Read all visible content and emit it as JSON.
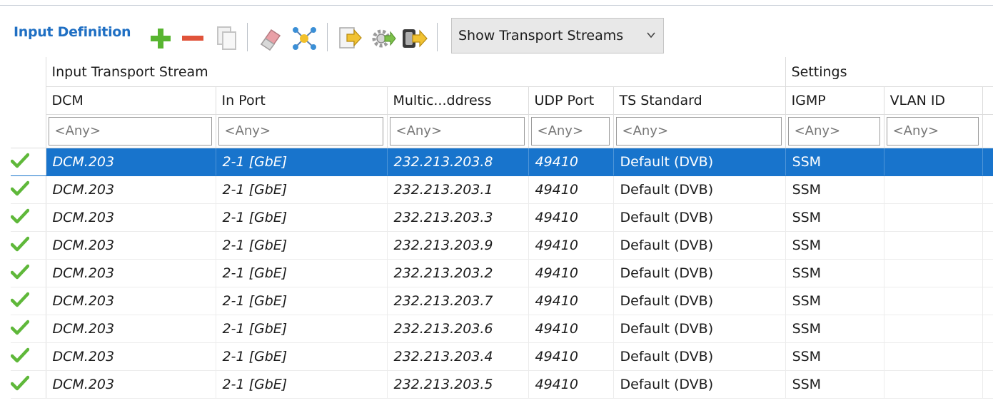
{
  "toolbar": {
    "title": "Input Definition",
    "icons": [
      "add-icon",
      "remove-icon",
      "copy-icon",
      "eraser-icon",
      "network-icon",
      "import-icon",
      "settings-gear-icon",
      "export-icon"
    ],
    "dropdown_value": "Show Transport Streams"
  },
  "table": {
    "groups": [
      {
        "label": ""
      },
      {
        "label": "Input Transport Stream"
      },
      {
        "label": "Settings"
      }
    ],
    "columns": [
      "DCM",
      "In Port",
      "Multic...ddress",
      "UDP Port",
      "TS Standard",
      "IGMP",
      "VLAN ID"
    ],
    "filter_placeholder": "<Any>",
    "rows": [
      {
        "status": "ok",
        "dcm": "DCM.203",
        "port": "2-1 [GbE]",
        "mcast": "232.213.203.8",
        "udp": "49410",
        "ts": "Default (DVB)",
        "igmp": "SSM",
        "vlan": ""
      },
      {
        "status": "ok",
        "dcm": "DCM.203",
        "port": "2-1 [GbE]",
        "mcast": "232.213.203.1",
        "udp": "49410",
        "ts": "Default (DVB)",
        "igmp": "SSM",
        "vlan": ""
      },
      {
        "status": "ok",
        "dcm": "DCM.203",
        "port": "2-1 [GbE]",
        "mcast": "232.213.203.3",
        "udp": "49410",
        "ts": "Default (DVB)",
        "igmp": "SSM",
        "vlan": ""
      },
      {
        "status": "ok",
        "dcm": "DCM.203",
        "port": "2-1 [GbE]",
        "mcast": "232.213.203.9",
        "udp": "49410",
        "ts": "Default (DVB)",
        "igmp": "SSM",
        "vlan": ""
      },
      {
        "status": "ok",
        "dcm": "DCM.203",
        "port": "2-1 [GbE]",
        "mcast": "232.213.203.2",
        "udp": "49410",
        "ts": "Default (DVB)",
        "igmp": "SSM",
        "vlan": ""
      },
      {
        "status": "ok",
        "dcm": "DCM.203",
        "port": "2-1 [GbE]",
        "mcast": "232.213.203.7",
        "udp": "49410",
        "ts": "Default (DVB)",
        "igmp": "SSM",
        "vlan": ""
      },
      {
        "status": "ok",
        "dcm": "DCM.203",
        "port": "2-1 [GbE]",
        "mcast": "232.213.203.6",
        "udp": "49410",
        "ts": "Default (DVB)",
        "igmp": "SSM",
        "vlan": ""
      },
      {
        "status": "ok",
        "dcm": "DCM.203",
        "port": "2-1 [GbE]",
        "mcast": "232.213.203.4",
        "udp": "49410",
        "ts": "Default (DVB)",
        "igmp": "SSM",
        "vlan": ""
      },
      {
        "status": "ok",
        "dcm": "DCM.203",
        "port": "2-1 [GbE]",
        "mcast": "232.213.203.5",
        "udp": "49410",
        "ts": "Default (DVB)",
        "igmp": "SSM",
        "vlan": ""
      }
    ],
    "selected_row": 0
  },
  "colors": {
    "title": "#1f6fc3",
    "selection": "#1874cc",
    "check": "#5fb83a"
  }
}
